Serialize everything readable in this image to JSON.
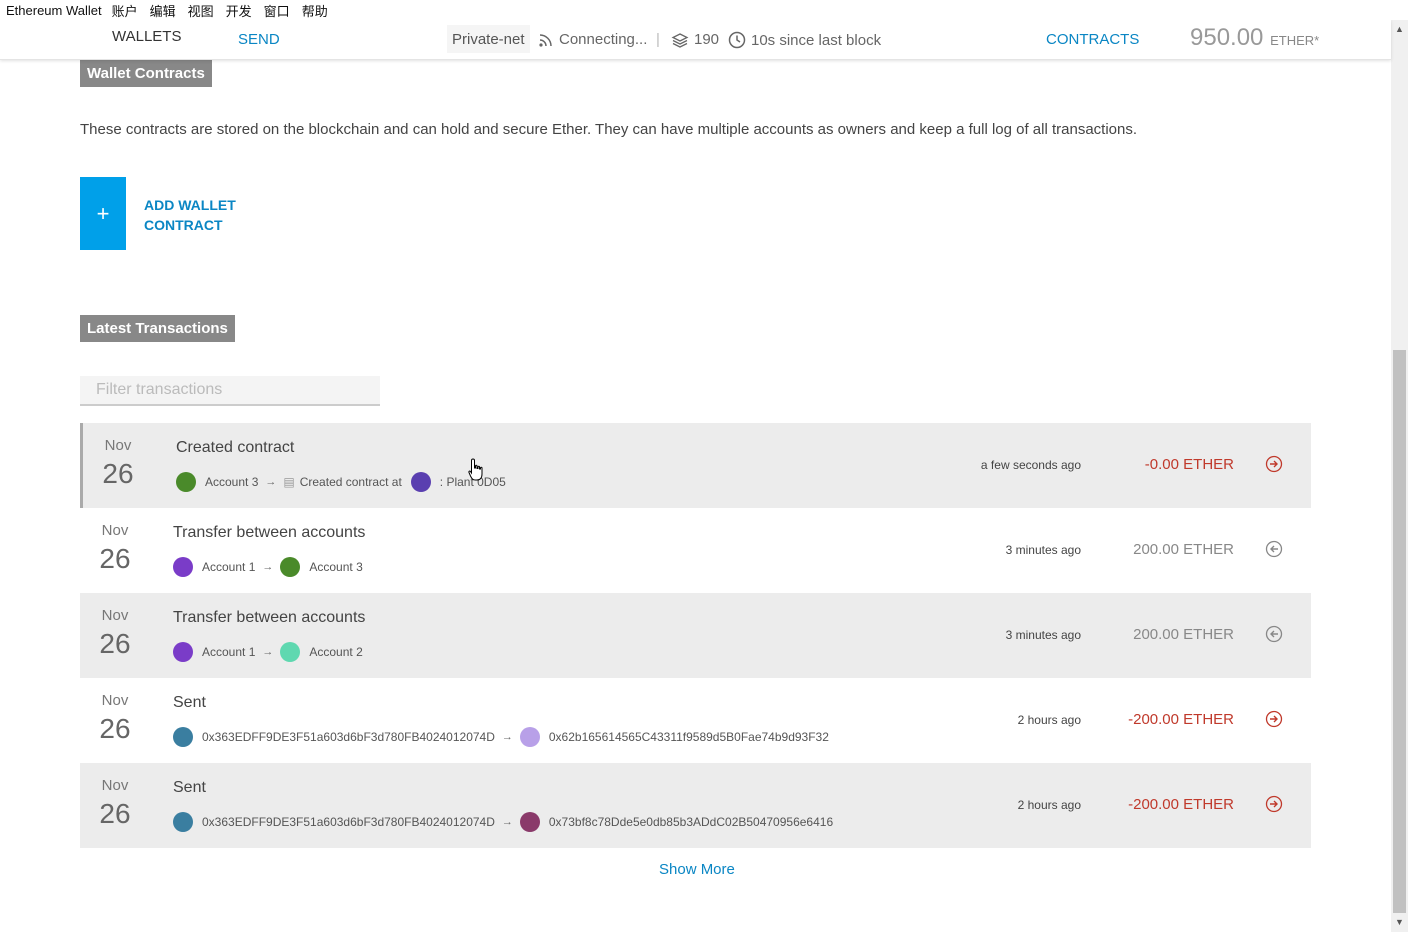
{
  "menubar": {
    "app_title": "Ethereum Wallet",
    "items": [
      "账户",
      "编辑",
      "视图",
      "开发",
      "窗口",
      "帮助"
    ]
  },
  "nav": {
    "wallets": "WALLETS",
    "send": "SEND",
    "network": "Private-net",
    "connection": "Connecting...",
    "separator": "|",
    "block_number": "190",
    "block_time": "10s since last block",
    "contracts": "CONTRACTS",
    "balance": "950.00",
    "balance_unit": "ETHER*"
  },
  "wallet_contracts": {
    "title": "Wallet Contracts",
    "description": "These contracts are stored on the blockchain and can hold and secure Ether. They can have multiple accounts as owners and keep a full log of all transactions.",
    "add_icon": "+",
    "add_line1": "ADD WALLET",
    "add_line2": "CONTRACT"
  },
  "transactions": {
    "title": "Latest Transactions",
    "filter_placeholder": "Filter transactions",
    "arrow": "→",
    "items": [
      {
        "month": "Nov",
        "day": "26",
        "title": "Created contract",
        "from": "Account 3",
        "from_color": "#4a8a2a",
        "extra": "Created contract at",
        "extra_icon": "document-icon",
        "to": ": Plant 0D05",
        "to_color": "#5a3fb0",
        "time": "a few seconds ago",
        "amount": "-0.00 ETHER",
        "direction": "out"
      },
      {
        "month": "Nov",
        "day": "26",
        "title": "Transfer between accounts",
        "from": "Account 1",
        "from_color": "#7a3cc8",
        "to": "Account 3",
        "to_color": "#4a8a2a",
        "time": "3 minutes ago",
        "amount": "200.00 ETHER",
        "direction": "in"
      },
      {
        "month": "Nov",
        "day": "26",
        "title": "Transfer between accounts",
        "from": "Account 1",
        "from_color": "#7a3cc8",
        "to": "Account 2",
        "to_color": "#5fd8b0",
        "time": "3 minutes ago",
        "amount": "200.00 ETHER",
        "direction": "in"
      },
      {
        "month": "Nov",
        "day": "26",
        "title": "Sent",
        "from": "0x363EDFF9DE3F51a603d6bF3d780FB4024012074D",
        "from_color": "#3a7ea0",
        "to": "0x62b165614565C43311f9589d5B0Fae74b9d93F32",
        "to_color": "#b8a0e8",
        "time": "2 hours ago",
        "amount": "-200.00 ETHER",
        "direction": "out"
      },
      {
        "month": "Nov",
        "day": "26",
        "title": "Sent",
        "from": "0x363EDFF9DE3F51a603d6bF3d780FB4024012074D",
        "from_color": "#3a7ea0",
        "to": "0x73bf8c78Dde5e0db85b3ADdC02B50470956e6416",
        "to_color": "#8a3a6a",
        "time": "2 hours ago",
        "amount": "-200.00 ETHER",
        "direction": "out"
      }
    ],
    "show_more": "Show More"
  },
  "colors": {
    "accent": "#0a86c4",
    "add_button": "#00a0e9",
    "negative": "#c0392b",
    "section_title_bg": "#888888"
  }
}
